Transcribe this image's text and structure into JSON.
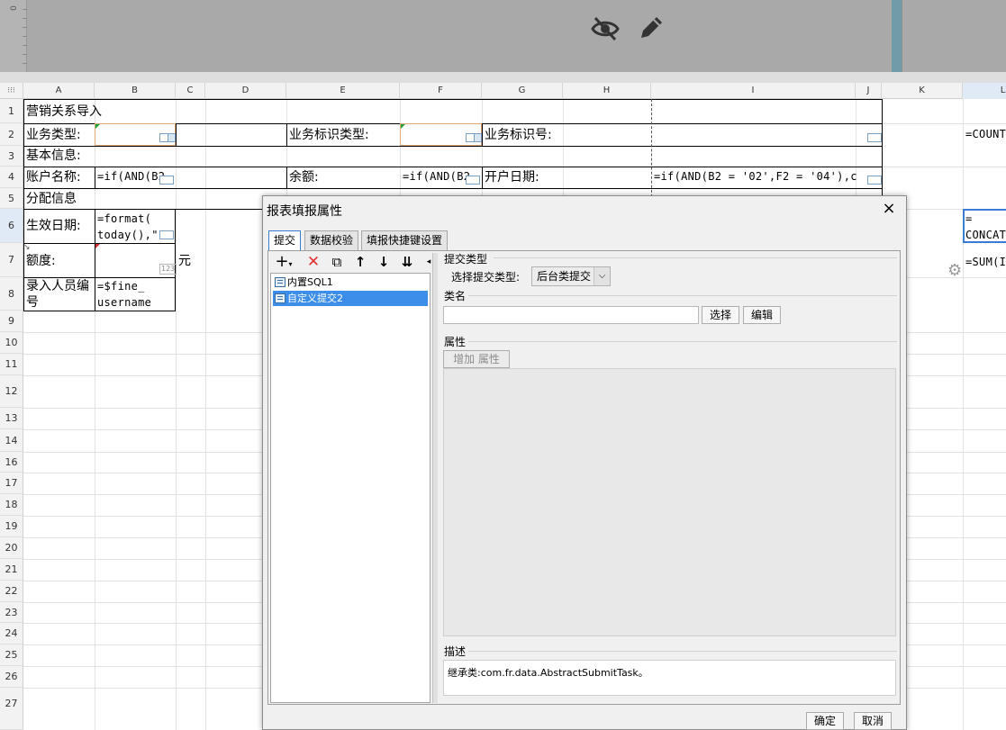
{
  "ruler": {
    "zero_label": "0"
  },
  "preview_icons": [
    "eye-slash-icon",
    "pencil-icon"
  ],
  "columns": [
    "A",
    "B",
    "C",
    "D",
    "E",
    "F",
    "G",
    "H",
    "I",
    "J",
    "K",
    "L"
  ],
  "rows": [
    "1",
    "2",
    "3",
    "4",
    "5",
    "6",
    "7",
    "8",
    "9",
    "10",
    "11",
    "12",
    "13",
    "14",
    "16",
    "17",
    "18",
    "19",
    "20",
    "21",
    "22",
    "23",
    "24",
    "25",
    "26",
    "27"
  ],
  "cells": {
    "a1": "营销关系导入",
    "a2": "业务类型:",
    "e2": "业务标识类型:",
    "g2": "业务标识号:",
    "a3": "基本信息:",
    "a4": "账户名称:",
    "b4": "=if(AND(B2",
    "e4": "余额:",
    "f4": "=if(AND(B2",
    "g4": "开户日期:",
    "i4": "=if(AND(B2 = '02',F2 = '04'),c",
    "a5": "分配信息",
    "a6": "生效日期:",
    "b6_line1": "=format(",
    "b6_line2": "today(),\"",
    "a7": "额度:",
    "b7_widget": "123",
    "c7": "元",
    "a8_line1": "录入人员编",
    "a8_line2": "号",
    "b8_line1": "=$fine_",
    "b8_line2": "username",
    "l2": "=COUNT",
    "l6_line1": "=",
    "l6_line2": "CONCAT",
    "l7": "=SUM(I"
  },
  "dialog": {
    "title": "报表填报属性",
    "close": "×",
    "tabs": [
      "提交",
      "数据校验",
      "填报快捷键设置"
    ],
    "tree_items": [
      "内置SQL1",
      "自定义提交2"
    ],
    "submit_type_section": "提交类型",
    "submit_type_label": "选择提交类型:",
    "submit_type_value": "后台类提交",
    "classname_section": "类名",
    "classname_value": "",
    "choose_button": "选择",
    "edit_button": "编辑",
    "property_section": "属性",
    "add_property_button": "增加 属性",
    "description_section": "描述",
    "description_text": "继承类:com.fr.data.AbstractSubmitTask。",
    "ok_button": "确定",
    "cancel_button": "取消"
  }
}
